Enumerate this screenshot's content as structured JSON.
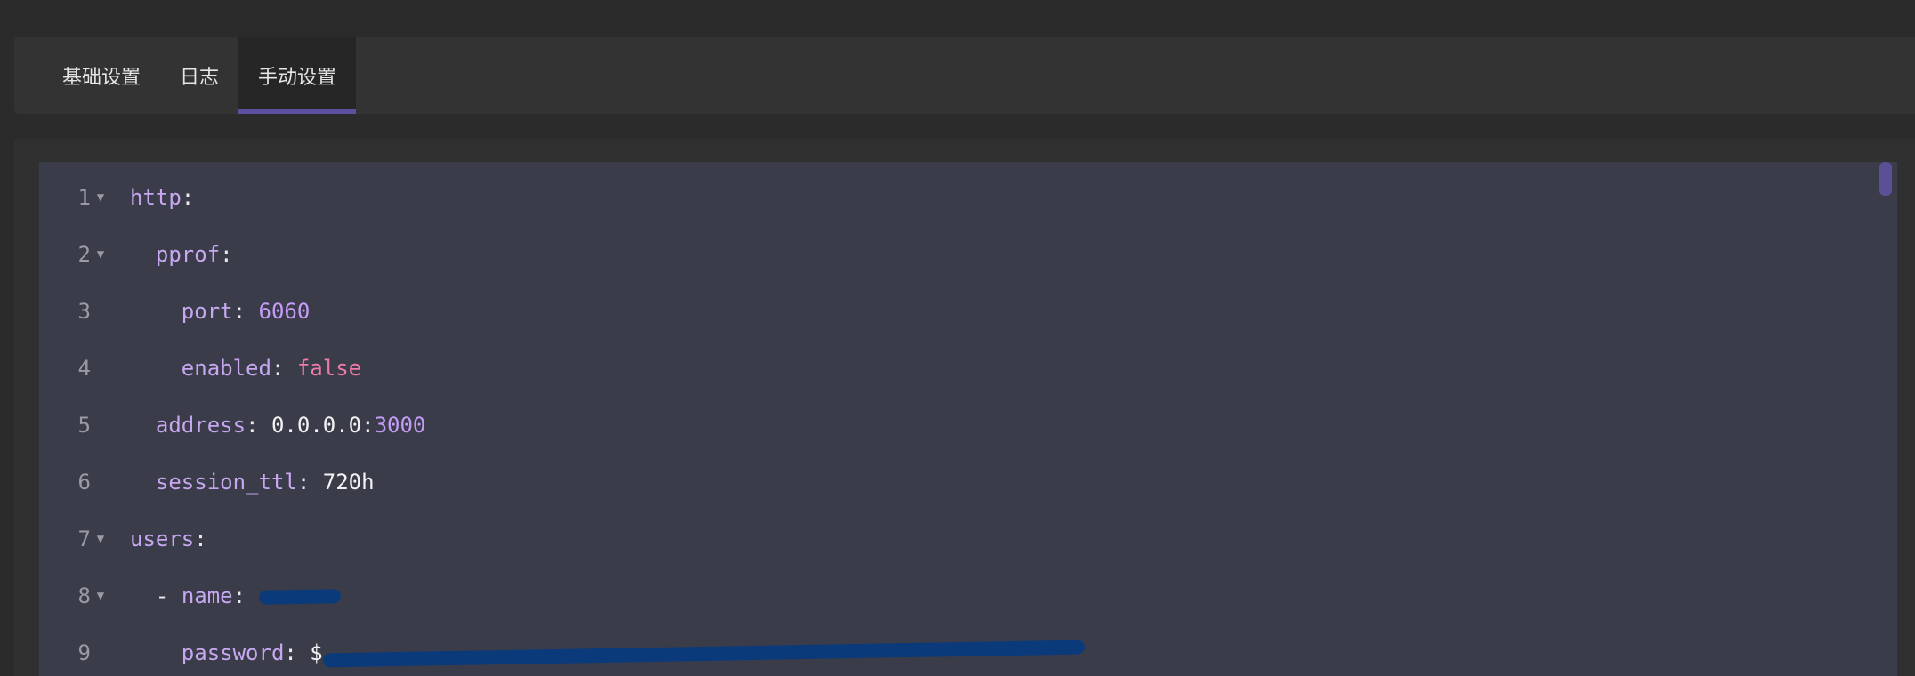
{
  "tabs": [
    {
      "label": "基础设置",
      "active": false
    },
    {
      "label": "日志",
      "active": false
    },
    {
      "label": "手动设置",
      "active": true
    }
  ],
  "colors": {
    "accent": "#5f4fa0",
    "key": "#c7a8f0",
    "number": "#c49cf7",
    "boolean": "#f07aa6",
    "editor_bg": "#3b3c4a",
    "redaction": "#0b3a7a"
  },
  "editor": {
    "lines": [
      {
        "no": "1",
        "fold": true,
        "indent": "",
        "key": "http",
        "sep": ":"
      },
      {
        "no": "2",
        "fold": true,
        "indent": "  ",
        "key": "pprof",
        "sep": ":"
      },
      {
        "no": "3",
        "fold": false,
        "indent": "    ",
        "key": "port",
        "sep": ": ",
        "value": "6060"
      },
      {
        "no": "4",
        "fold": false,
        "indent": "    ",
        "key": "enabled",
        "sep": ": ",
        "value": "false"
      },
      {
        "no": "5",
        "fold": false,
        "indent": "  ",
        "key": "address",
        "sep": ": ",
        "value": "0.0.0.0:",
        "value2": "3000"
      },
      {
        "no": "6",
        "fold": false,
        "indent": "  ",
        "key": "session_ttl",
        "sep": ": ",
        "value": "720h"
      },
      {
        "no": "7",
        "fold": true,
        "indent": "",
        "key": "users",
        "sep": ":"
      },
      {
        "no": "8",
        "fold": true,
        "indent": "  ",
        "dash": "- ",
        "key": "name",
        "sep": ": "
      },
      {
        "no": "9",
        "fold": false,
        "indent": "    ",
        "key": "password",
        "sep": ": ",
        "value": "$"
      }
    ],
    "fold_icon": "caret-down-icon"
  }
}
